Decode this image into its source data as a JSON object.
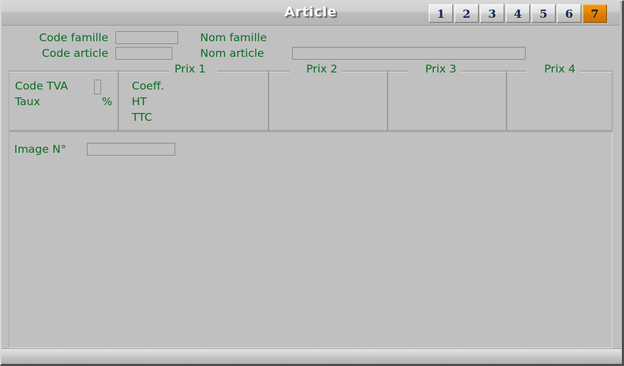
{
  "window": {
    "title": "Article"
  },
  "tabs": [
    {
      "label": "1",
      "active": false
    },
    {
      "label": "2",
      "active": false
    },
    {
      "label": "3",
      "active": false
    },
    {
      "label": "4",
      "active": false
    },
    {
      "label": "5",
      "active": false
    },
    {
      "label": "6",
      "active": false
    },
    {
      "label": "7",
      "active": true
    }
  ],
  "header_fields": {
    "code_famille_label": "Code famille",
    "code_famille_value": "",
    "nom_famille_label": "Nom famille",
    "nom_famille_value": "",
    "code_article_label": "Code article",
    "code_article_value": "",
    "nom_article_label": "Nom article",
    "nom_article_value": ""
  },
  "tva": {
    "code_tva_label": "Code TVA",
    "code_tva_value": "",
    "taux_label": "Taux",
    "taux_value": "",
    "percent_symbol": "%"
  },
  "price_groups": [
    {
      "legend": "Prix 1",
      "rows": [
        {
          "label": "Coeff.",
          "value": ""
        },
        {
          "label": "HT",
          "value": ""
        },
        {
          "label": "TTC",
          "value": ""
        }
      ]
    },
    {
      "legend": "Prix 2",
      "rows": []
    },
    {
      "legend": "Prix 3",
      "rows": []
    },
    {
      "legend": "Prix 4",
      "rows": []
    }
  ],
  "image_section": {
    "image_no_label": "Image N°",
    "image_no_value": ""
  },
  "statusbar": {
    "text": ""
  },
  "colors": {
    "window_background": "#c0c0c0",
    "label_green": "#0a6b21",
    "tab_active_orange": "#e5860a",
    "title_text": "#ffffff",
    "field_border": "#8b8b8b"
  }
}
